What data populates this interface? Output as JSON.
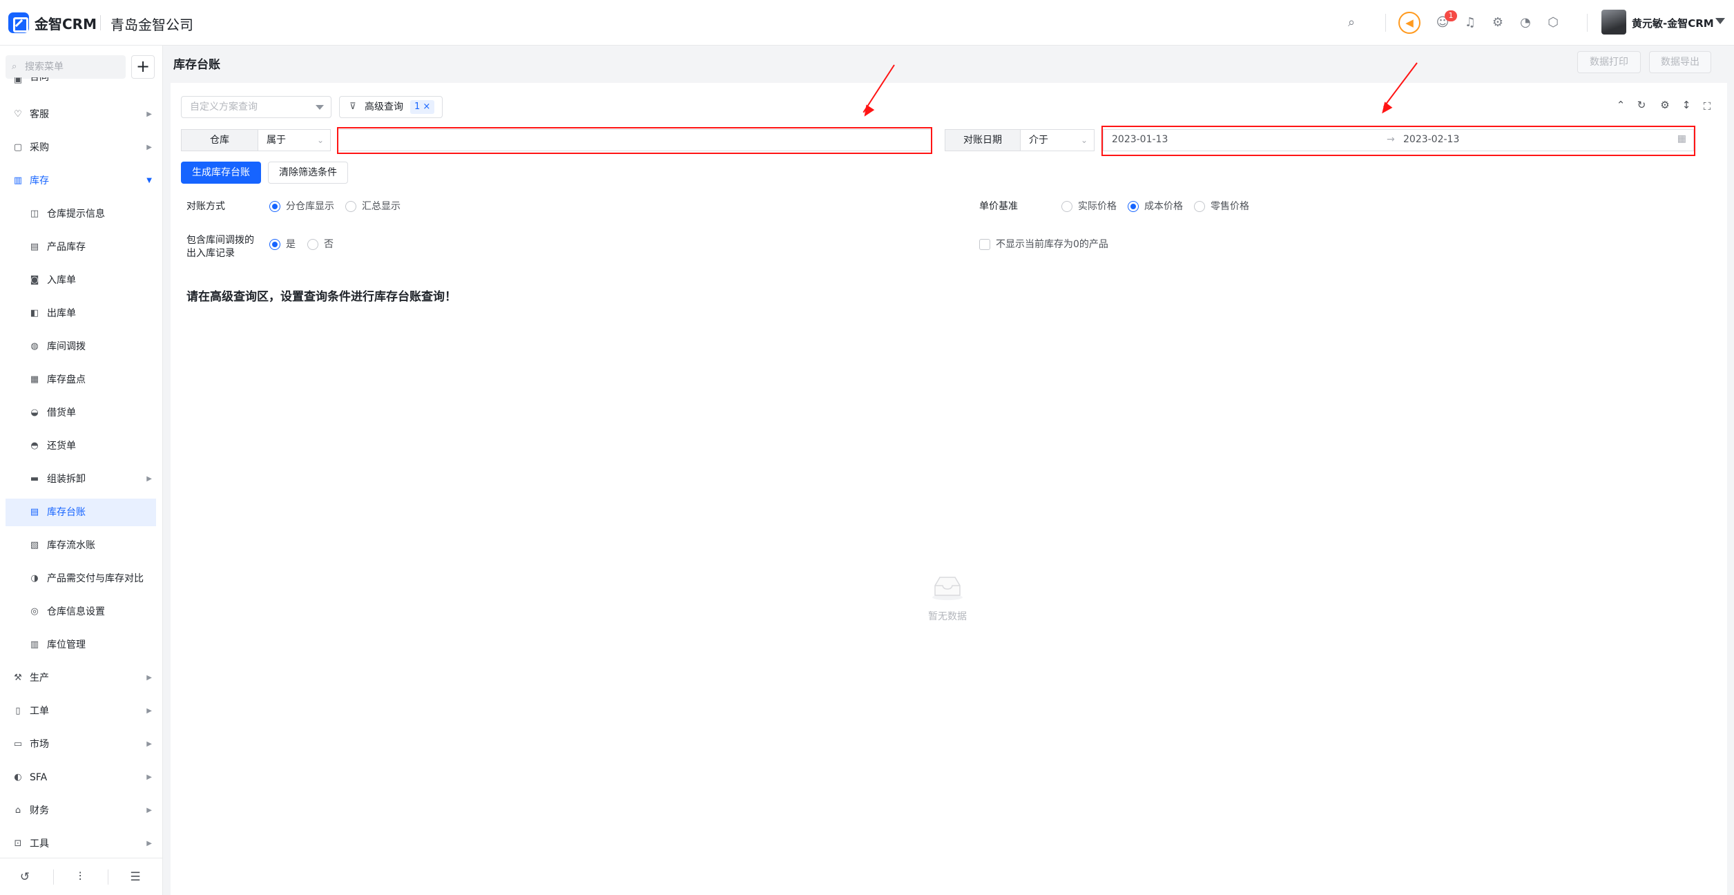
{
  "header": {
    "app_name": "金智CRM",
    "company": "青岛金智公司",
    "notification_count": "1",
    "user_name": "黄元敏-金智CRM"
  },
  "sidebar": {
    "search_placeholder": "搜索菜单",
    "items": [
      {
        "label": "合同",
        "icon": "contract-icon",
        "level": 1
      },
      {
        "label": "客服",
        "icon": "headset-icon",
        "level": 1
      },
      {
        "label": "采购",
        "icon": "cart-icon",
        "level": 1
      },
      {
        "label": "库存",
        "icon": "warehouse-icon",
        "level": 1,
        "open": true
      },
      {
        "label": "仓库提示信息",
        "icon": "info-icon",
        "level": 2
      },
      {
        "label": "产品库存",
        "icon": "doc-icon",
        "level": 2
      },
      {
        "label": "入库单",
        "icon": "inbound-icon",
        "level": 2
      },
      {
        "label": "出库单",
        "icon": "outbound-icon",
        "level": 2
      },
      {
        "label": "库间调拨",
        "icon": "transfer-icon",
        "level": 2
      },
      {
        "label": "库存盘点",
        "icon": "count-icon",
        "level": 2
      },
      {
        "label": "借货单",
        "icon": "borrow-icon",
        "level": 2
      },
      {
        "label": "还货单",
        "icon": "return-icon",
        "level": 2
      },
      {
        "label": "组装拆卸",
        "icon": "folder-icon",
        "level": 2,
        "has_children": true
      },
      {
        "label": "库存台账",
        "icon": "ledger-icon",
        "level": 2,
        "active": true
      },
      {
        "label": "库存流水账",
        "icon": "journal-icon",
        "level": 2
      },
      {
        "label": "产品需交付与库存对比",
        "icon": "compare-icon",
        "level": 2
      },
      {
        "label": "仓库信息设置",
        "icon": "settings-icon",
        "level": 2
      },
      {
        "label": "库位管理",
        "icon": "grid-icon",
        "level": 2
      },
      {
        "label": "生产",
        "icon": "production-icon",
        "level": 1
      },
      {
        "label": "工单",
        "icon": "ticket-icon",
        "level": 1
      },
      {
        "label": "市场",
        "icon": "market-icon",
        "level": 1
      },
      {
        "label": "SFA",
        "icon": "sfa-icon",
        "level": 1
      },
      {
        "label": "财务",
        "icon": "finance-icon",
        "level": 1
      },
      {
        "label": "工具",
        "icon": "tools-icon",
        "level": 1
      }
    ]
  },
  "page": {
    "title": "库存台账",
    "print_label": "数据打印",
    "export_label": "数据导出"
  },
  "toolbar": {
    "scheme_placeholder": "自定义方案查询",
    "advanced_label": "高级查询",
    "advanced_count": "1 ×"
  },
  "filters": {
    "warehouse_label": "仓库",
    "warehouse_op": "属于",
    "warehouse_value": "",
    "date_label": "对账日期",
    "date_op": "介于",
    "date_start": "2023-01-13",
    "date_end": "2023-02-13"
  },
  "actions": {
    "generate_label": "生成库存台账",
    "clear_label": "清除筛选条件"
  },
  "options": {
    "mode_label": "对账方式",
    "mode_options": [
      "分仓库显示",
      "汇总显示"
    ],
    "mode_selected": "分仓库显示",
    "price_label": "单价基准",
    "price_options": [
      "实际价格",
      "成本价格",
      "零售价格"
    ],
    "price_selected": "成本价格",
    "transfer_label_line1": "包含库间调拨的",
    "transfer_label_line2": "出入库记录",
    "transfer_options": [
      "是",
      "否"
    ],
    "transfer_selected": "是",
    "hide_zero_label": "不显示当前库存为0的产品",
    "hide_zero_checked": false
  },
  "hint": "请在高级查询区，设置查询条件进行库存台账查询！",
  "empty_text": "暂无数据"
}
